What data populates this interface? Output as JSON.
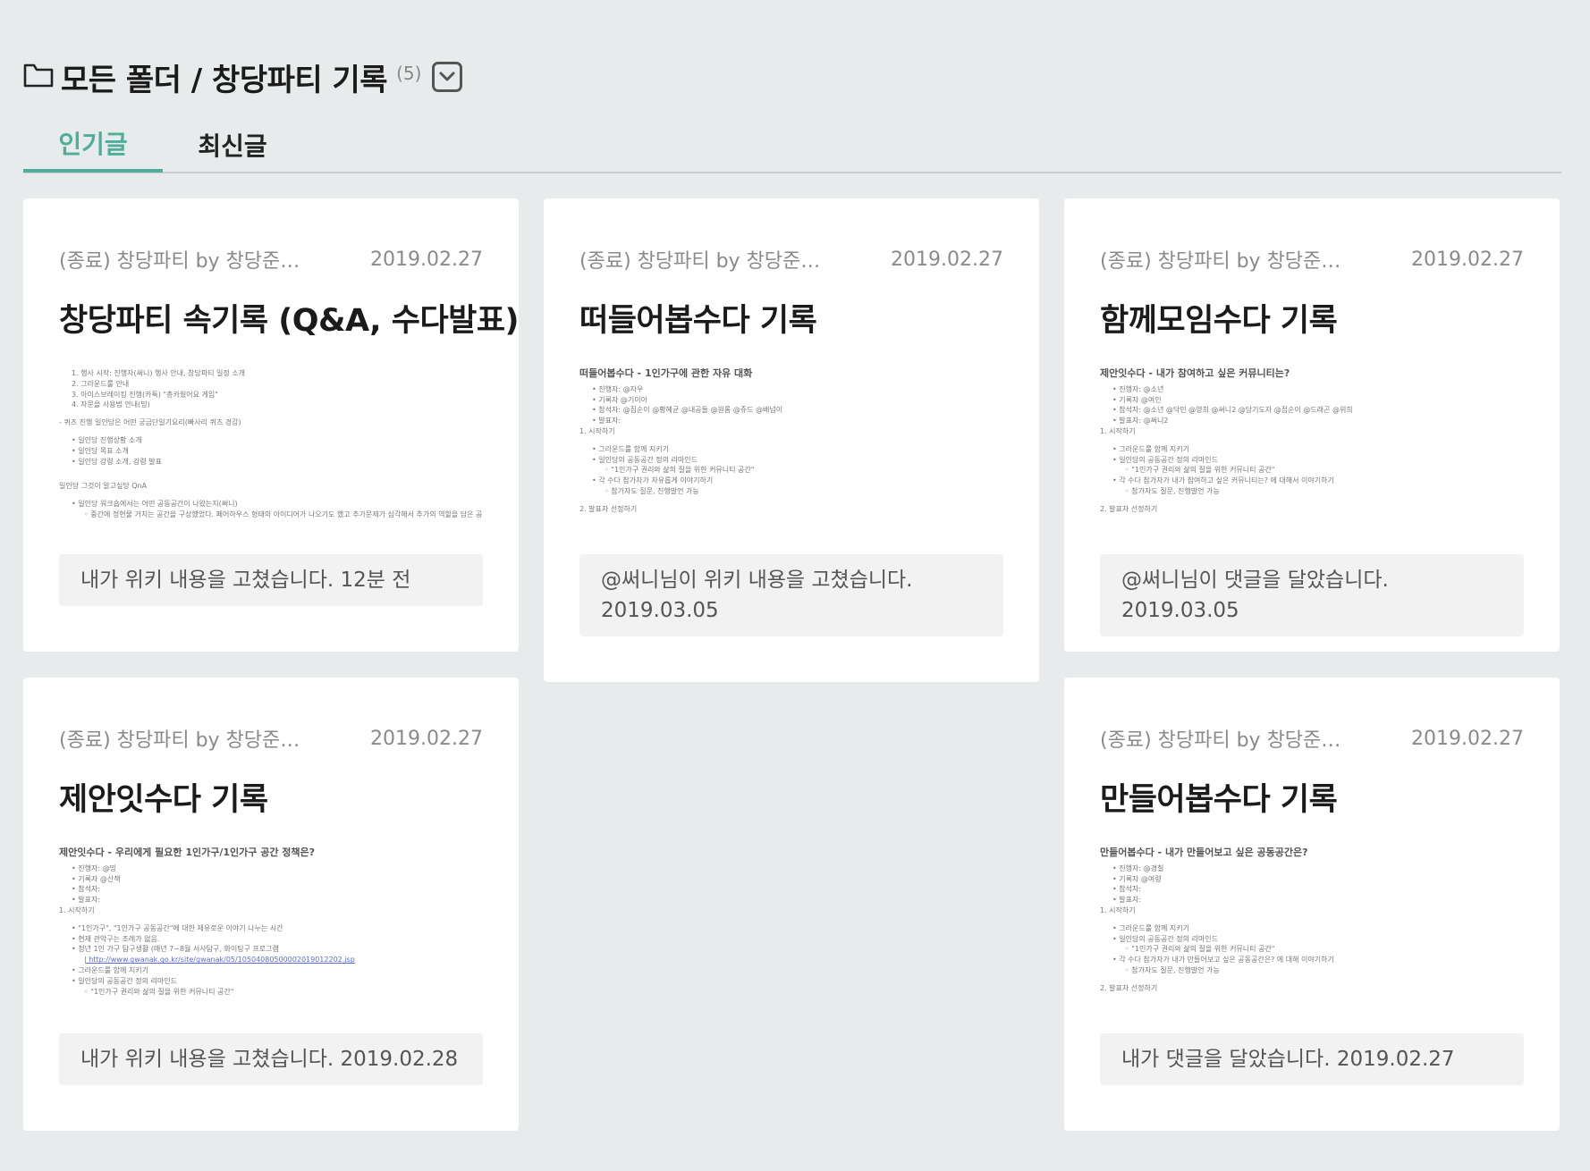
{
  "header": {
    "folder_icon": "folder-icon",
    "path": "모든 폴더 / 창당파티 기록",
    "count": "(5)",
    "dropdown_icon": "chevron-down-icon"
  },
  "tabs": [
    {
      "label": "인기글",
      "active": true
    },
    {
      "label": "최신글",
      "active": false
    }
  ],
  "colors": {
    "accent": "#4fae9a",
    "background": "#e8ebec"
  },
  "cards": [
    {
      "source": "(종료) 창당파티 by 창당준…",
      "date": "2019.02.27",
      "title": "창당파티 속기록 (Q&A, 수다발표)",
      "preview_heading": "",
      "preview_lines": [
        {
          "level": 1,
          "text": "1. 행사 시작: 진행자(써니) 행사 안내, 창당파티 일정 소개"
        },
        {
          "level": 1,
          "text": "2. 그라운드룰 안내"
        },
        {
          "level": 1,
          "text": "3. 아이스브레이킹 진행(카툭) \"총카웠어요 게임\""
        },
        {
          "level": 1,
          "text": "4. 자문을 사용법 안내(밍)"
        },
        {
          "level": 0,
          "text": ""
        },
        {
          "level": 0,
          "text": "- 퀴즈 진행 일인당은 어떤 궁금단일기요리(빠사리 퀴즈 경감)"
        },
        {
          "level": 0,
          "text": ""
        },
        {
          "level": 1,
          "text": "• 일인당 진행상황 소개"
        },
        {
          "level": 1,
          "text": "• 일인당 목표 소개"
        },
        {
          "level": 1,
          "text": "• 일인당 강령 소개, 강령 발표"
        },
        {
          "level": 0,
          "text": ""
        },
        {
          "level": 0,
          "text": ""
        },
        {
          "level": 0,
          "text": "일인당 그것이 알고싶당 QnA"
        },
        {
          "level": 0,
          "text": ""
        },
        {
          "level": 1,
          "text": "• 일인당 워크숍에서는 어떤 공동공간이 나왔는지(써니)"
        },
        {
          "level": 2,
          "text": "◦ 중간에 정현물 거치는 공간을 구상했었다. 페어하우스 형태의 아이디어가 나오기도 했고 추가문제가 심각해서 추가의 역할을 담은 공간을"
        }
      ],
      "activity": "내가 위키 내용을 고쳤습니다. 12분 전"
    },
    {
      "source": "(종료) 창당파티 by 창당준…",
      "date": "2019.02.27",
      "title": "떠들어봅수다 기록",
      "preview_heading": "떠들어봅수다 - 1인가구에 관한 자유 대화",
      "preview_lines": [
        {
          "level": 1,
          "text": "• 진행자: @자우"
        },
        {
          "level": 1,
          "text": "• 기록자 @기이아"
        },
        {
          "level": 1,
          "text": "• 참석자: @집순이 @황혜균 @내공들 @원롬 @쥬드 @배넘이"
        },
        {
          "level": 1,
          "text": "• 발표자:"
        },
        {
          "level": 0,
          "text": "1. 시작하기"
        },
        {
          "level": 0,
          "text": ""
        },
        {
          "level": 1,
          "text": "• 그라운드룰 함께 지키기"
        },
        {
          "level": 1,
          "text": "• 일인당의 공동공간 정의 리마인드"
        },
        {
          "level": 2,
          "text": "◦ \"1인가구 권리와 삶의 질을 위한 커뮤니티 공간\""
        },
        {
          "level": 1,
          "text": "• 각 수다 참가자가 자유롭게 이야기하기"
        },
        {
          "level": 2,
          "text": "◦ 참가자도 질문, 진행발언 가능"
        },
        {
          "level": 0,
          "text": ""
        },
        {
          "level": 0,
          "text": "2. 발표자 선정하기"
        }
      ],
      "activity": "@써니님이 위키 내용을 고쳤습니다. 2019.03.05"
    },
    {
      "source": "(종료) 창당파티 by 창당준…",
      "date": "2019.02.27",
      "title": "함께모임수다 기록",
      "preview_heading": "제안잇수다 - 내가 참여하고 싶은 커뮤니티는?",
      "preview_lines": [
        {
          "level": 1,
          "text": "• 진행자: @소년"
        },
        {
          "level": 1,
          "text": "• 기록자 @여인"
        },
        {
          "level": 1,
          "text": "• 참석자: @소년 @닥민 @영희 @써니2 @당기도자 @접순이 @드래곤 @위희"
        },
        {
          "level": 1,
          "text": "• 발표자: @써니2"
        },
        {
          "level": 0,
          "text": "1. 시작하기"
        },
        {
          "level": 0,
          "text": ""
        },
        {
          "level": 1,
          "text": "• 그라운드룰 함께 지키기"
        },
        {
          "level": 1,
          "text": "• 일인당의 공동공간 정의 리마인드"
        },
        {
          "level": 2,
          "text": "◦ \"1인가구 권리와 삶의 질을 위한 커뮤니티 공간\""
        },
        {
          "level": 1,
          "text": "• 각 수다 참가자가 내가 참여하고 싶은 커뮤니티는? 에 대해서 이야기하기"
        },
        {
          "level": 2,
          "text": "◦ 참가자도 질문, 진행발언 가능"
        },
        {
          "level": 0,
          "text": ""
        },
        {
          "level": 0,
          "text": "2. 발표자 선정하기"
        }
      ],
      "activity": "@써니님이 댓글을 달았습니다. 2019.03.05"
    },
    {
      "source": "(종료) 창당파티 by 창당준…",
      "date": "2019.02.27",
      "title": "제안잇수다 기록",
      "preview_heading": "제안잇수다 - 우리에게 필요한 1인가구/1인가구 공간 정책은?",
      "preview_lines": [
        {
          "level": 1,
          "text": "• 진행자: @밍"
        },
        {
          "level": 1,
          "text": "• 기록자 @산책"
        },
        {
          "level": 1,
          "text": "• 참석자:"
        },
        {
          "level": 1,
          "text": "• 발표자:"
        },
        {
          "level": 0,
          "text": "1. 시작하기"
        },
        {
          "level": 0,
          "text": ""
        },
        {
          "level": 1,
          "text": "• \"1인가구\", \"1인가구 공동공간\"에 대한 제유로운 이야기 나누는 시간"
        },
        {
          "level": 1,
          "text": "• 현재 관악구는 조례가 없음."
        },
        {
          "level": 1,
          "text": "• 청년 1인 가구 탐구생활 (매년 7~8월 서사탐구, 화이팅구 프로그램"
        },
        {
          "level": 2,
          "text": "| http://www.gwanak.go.kr/site/gwanak/05/10504080500002019012202.jsp"
        },
        {
          "level": 1,
          "text": "• 그라운드룰 함께 지키기"
        },
        {
          "level": 1,
          "text": "• 일인당의 공동공간 정의 리마인드"
        },
        {
          "level": 2,
          "text": "◦ \"1인가구 권리와 삶의 질을 위한 커뮤니티 공간\""
        }
      ],
      "activity": "내가 위키 내용을 고쳤습니다. 2019.02.28"
    },
    {
      "source": "(종료) 창당파티 by 창당준…",
      "date": "2019.02.27",
      "title": "만들어봅수다 기록",
      "preview_heading": "만들어봅수다 - 내가 만들어보고 싶은 공동공간은?",
      "preview_lines": [
        {
          "level": 1,
          "text": "• 진행자: @경칠"
        },
        {
          "level": 1,
          "text": "• 기록자 @여령"
        },
        {
          "level": 1,
          "text": "• 참석자:"
        },
        {
          "level": 1,
          "text": "• 발표자:"
        },
        {
          "level": 0,
          "text": "1. 시작하기"
        },
        {
          "level": 0,
          "text": ""
        },
        {
          "level": 1,
          "text": "• 그라운드룰 함께 지키기"
        },
        {
          "level": 1,
          "text": "• 일인당의 공동공간 정의 리마인드"
        },
        {
          "level": 2,
          "text": "◦ \"1인가구 권리와 삶의 질을 위한 커뮤니티 공간\""
        },
        {
          "level": 1,
          "text": "• 각 수다 참가자가 내가 만들어보고 싶은 공동공간은? 에 대해 이야기하기"
        },
        {
          "level": 2,
          "text": "◦ 참가자도 질문, 진행발언 가능"
        },
        {
          "level": 0,
          "text": ""
        },
        {
          "level": 0,
          "text": "2. 발표자 선정하기"
        }
      ],
      "activity": "내가 댓글을 달았습니다. 2019.02.27"
    }
  ]
}
